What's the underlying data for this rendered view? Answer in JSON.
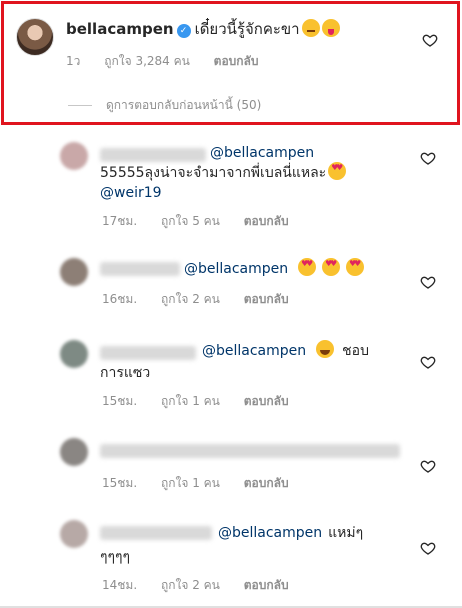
{
  "main_comment": {
    "username": "bellacampen",
    "text": "เดี๋ยวนี้รู้จักคะขา",
    "emojis": [
      "smirk",
      "tongue"
    ],
    "time": "1ว",
    "likes": "ถูกใจ 3,284 คน",
    "reply": "ตอบกลับ",
    "view_replies": "ดูการตอบกลับก่อนหน้านี้ (50)"
  },
  "replies": [
    {
      "avatar_color": "#c9a8a8",
      "mention": "@bellacampen",
      "line2": "55555ลุงน่าจะจำมาจากพี่เบลนี่แหละ",
      "line3_mention": "@weir19",
      "time": "17ชม.",
      "likes": "ถูกใจ 5 คน",
      "reply": "ตอบกลับ"
    },
    {
      "avatar_color": "#8d7f76",
      "mention": "@bellacampen",
      "time": "16ชม.",
      "likes": "ถูกใจ 2 คน",
      "reply": "ตอบกลับ"
    },
    {
      "avatar_color": "#7e8a84",
      "mention": "@bellacampen",
      "text_after": "ชอบ",
      "line2": "การแซว",
      "time": "15ชม.",
      "likes": "ถูกใจ 1 คน",
      "reply": "ตอบกลับ"
    },
    {
      "avatar_color": "#8a8683",
      "time": "15ชม.",
      "likes": "ถูกใจ 1 คน",
      "reply": "ตอบกลับ"
    },
    {
      "avatar_color": "#b7a9a6",
      "mention": "@bellacampen",
      "text_after": "แหม่ๆ",
      "line2": "ๆๆๆๆ",
      "time": "14ชม.",
      "likes": "ถูกใจ 2 คน",
      "reply": "ตอบกลับ"
    }
  ],
  "icons": {
    "like": "heart-icon",
    "verified": "verified-badge-icon"
  },
  "colors": {
    "highlight_border": "#e0141e",
    "mention": "#003569",
    "verified": "#3897f0",
    "meta_text": "#8e8e8e"
  }
}
